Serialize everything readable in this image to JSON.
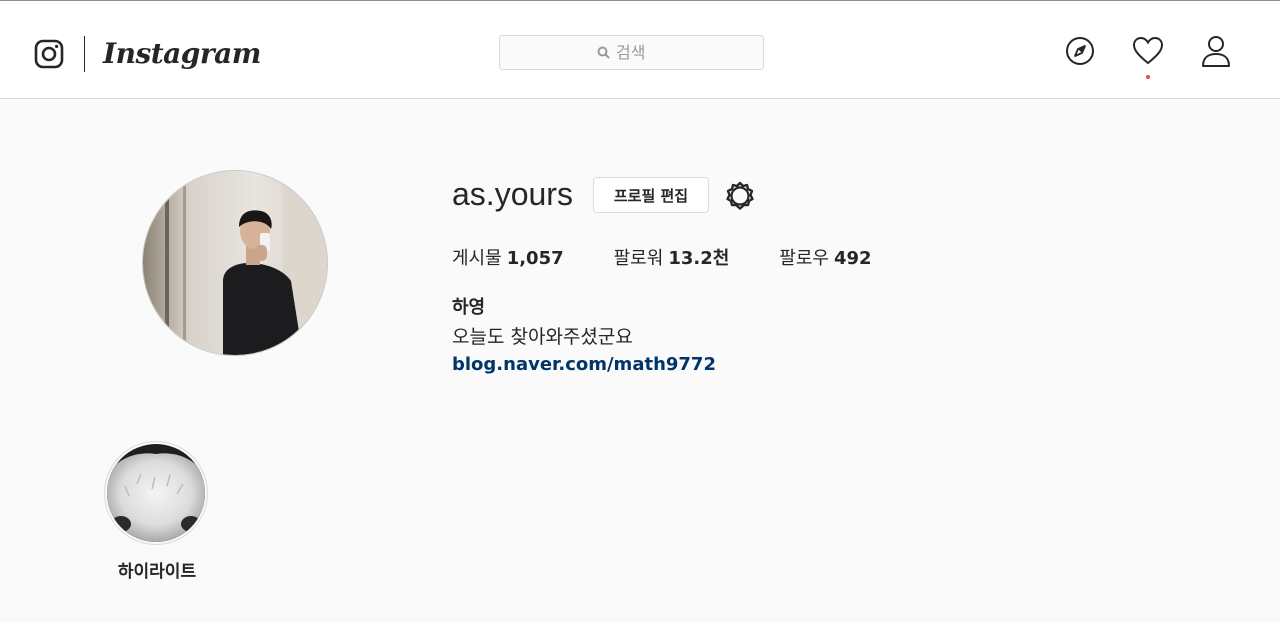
{
  "brand": {
    "wordmark": "Instagram"
  },
  "search": {
    "placeholder": "검색"
  },
  "nav": {
    "icons": [
      "compass-icon",
      "heart-icon",
      "person-icon"
    ],
    "notification_dot_color": "#ed4956"
  },
  "profile": {
    "username": "as.yours",
    "edit_label": "프로필 편집",
    "stats": [
      {
        "label": "게시물",
        "value": "1,057"
      },
      {
        "label": "팔로워",
        "value": "13.2천"
      },
      {
        "label": "팔로우",
        "value": "492"
      }
    ],
    "full_name": "하영",
    "bio": "오늘도 찾아와주셨군요",
    "link": "blog.naver.com/math9772"
  },
  "highlights": [
    {
      "label": "하이라이트"
    }
  ],
  "colors": {
    "link": "#003569",
    "border": "#dbdbdb",
    "background": "#fafafa"
  }
}
